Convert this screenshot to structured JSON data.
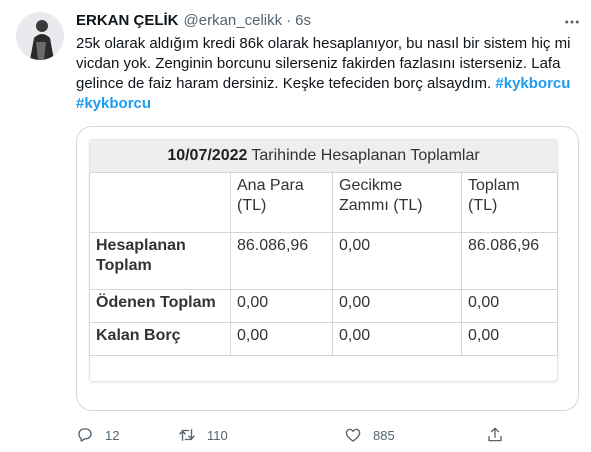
{
  "tweet": {
    "author_name": "ERKAN ÇELİK",
    "handle": "@erkan_celikk",
    "separator": "·",
    "time": "6s",
    "text_main": "25k olarak aldığım kredi 86k olarak hesaplanıyor, bu nasıl bir sistem hiç mi vicdan yok. Zenginin borcunu silerseniz fakirden fazlasını isterseniz. Lafa gelince de faiz haram dersiniz. Keşke tefeciden borç alsaydım.",
    "hashtags": [
      "#kykborcu",
      "#kykborcu"
    ]
  },
  "table_image": {
    "title_date": "10/07/2022",
    "title_rest": "Tarihinde Hesaplanan Toplamlar",
    "headers": [
      "",
      "Ana Para (TL)",
      "Gecikme Zammı (TL)",
      "Toplam (TL)"
    ],
    "rows": [
      {
        "label": "Hesaplanan Toplam",
        "ana_para": "86.086,96",
        "gecikme": "0,00",
        "toplam": "86.086,96"
      },
      {
        "label": "Ödenen Toplam",
        "ana_para": "0,00",
        "gecikme": "0,00",
        "toplam": "0,00"
      },
      {
        "label": "Kalan Borç",
        "ana_para": "0,00",
        "gecikme": "0,00",
        "toplam": "0,00"
      }
    ]
  },
  "actions": {
    "reply_count": "12",
    "retweet_count": "110",
    "like_count": "885"
  },
  "icons": {
    "more": "more-dots-icon",
    "reply": "reply-icon",
    "retweet": "retweet-icon",
    "like": "heart-icon",
    "share": "share-icon"
  },
  "colors": {
    "hashtag": "#1d9bf0",
    "muted": "#536471",
    "card_border": "#cfd9de"
  }
}
